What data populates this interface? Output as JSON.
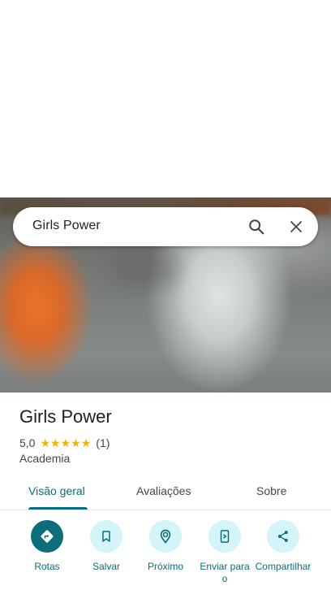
{
  "search": {
    "query": "Girls Power",
    "search_icon": "search-icon",
    "close_icon": "close-icon"
  },
  "place": {
    "name": "Girls Power",
    "rating": "5,0",
    "stars": 5,
    "review_count": "(1)",
    "category": "Academia"
  },
  "tabs": [
    {
      "label": "Visão geral",
      "active": true
    },
    {
      "label": "Avaliações",
      "active": false
    },
    {
      "label": "Sobre",
      "active": false
    }
  ],
  "actions": [
    {
      "label": "Rotas",
      "icon": "directions-icon"
    },
    {
      "label": "Salvar",
      "icon": "bookmark-icon"
    },
    {
      "label": "Próximo",
      "icon": "nearby-icon"
    },
    {
      "label": "Enviar para o",
      "icon": "send-to-phone-icon"
    },
    {
      "label": "Compartilhar",
      "icon": "share-icon"
    }
  ],
  "colors": {
    "accent": "#0b6e7a",
    "accent_light": "#d3f4f8",
    "star": "#f4b400"
  }
}
